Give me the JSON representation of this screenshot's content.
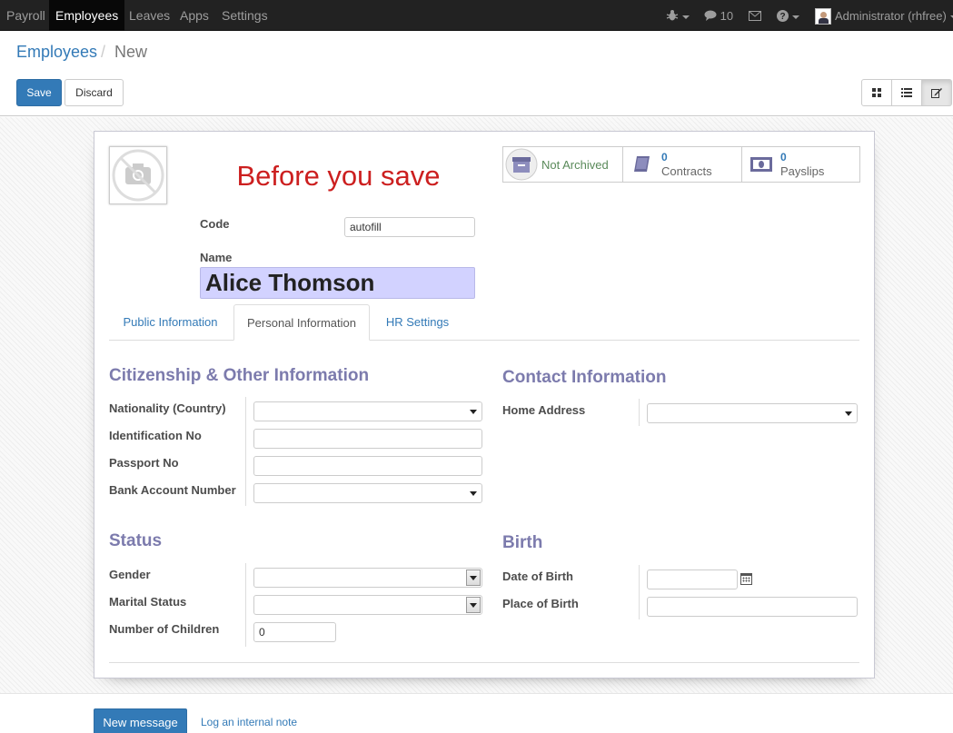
{
  "topbar": {
    "menu": [
      "Payroll",
      "Employees",
      "Leaves",
      "Apps",
      "Settings"
    ],
    "active": "Employees",
    "messages_count": "10",
    "user": "Administrator (rhfree)"
  },
  "breadcrumb": {
    "parent": "Employees",
    "separator": "/",
    "current": "New"
  },
  "buttons": {
    "save": "Save",
    "discard": "Discard"
  },
  "view_switcher": [
    "kanban-view-icon",
    "list-view-icon",
    "form-view-icon"
  ],
  "warning": "Before you save",
  "stats": [
    {
      "value": "",
      "label": "Not Archived",
      "icon": "archive-icon"
    },
    {
      "value": "0",
      "label": "Contracts",
      "icon": "book-icon"
    },
    {
      "value": "0",
      "label": "Payslips",
      "icon": "money-icon"
    }
  ],
  "form": {
    "code_label": "Code",
    "code_value": "autofill",
    "name_label": "Name",
    "name_value": "Alice Thomson"
  },
  "tabs": [
    "Public Information",
    "Personal Information",
    "HR Settings"
  ],
  "active_tab": "Personal Information",
  "sections": {
    "citizenship": {
      "title": "Citizenship & Other Information",
      "fields": [
        "Nationality (Country)",
        "Identification No",
        "Passport No",
        "Bank Account Number"
      ]
    },
    "contact": {
      "title": "Contact Information",
      "fields": [
        "Home Address"
      ]
    },
    "status": {
      "title": "Status",
      "fields": [
        "Gender",
        "Marital Status",
        "Number of Children"
      ],
      "children_value": "0"
    },
    "birth": {
      "title": "Birth",
      "fields": [
        "Date of Birth",
        "Place of Birth"
      ]
    }
  },
  "chatter": {
    "new_message": "New message",
    "log_note": "Log an internal note"
  },
  "colors": {
    "brand_blue": "#337ab7",
    "warning_red": "#cc1f1f",
    "section_title": "#7c7bad",
    "name_highlight": "#d2d2ff"
  }
}
